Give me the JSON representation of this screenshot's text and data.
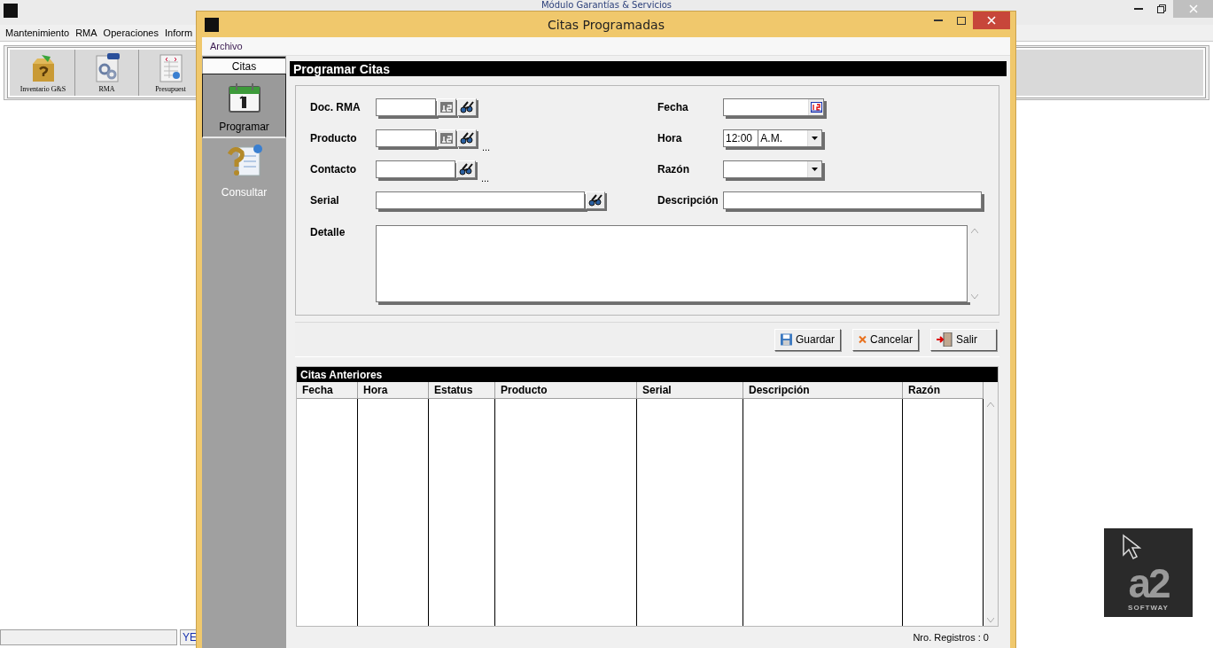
{
  "app_window": {
    "title": "Módulo Garantías & Servicios",
    "menu": [
      "Mantenimiento",
      "RMA",
      "Operaciones",
      "Inform"
    ],
    "toolbar": [
      {
        "label": "Inventario G&S",
        "kind": "box"
      },
      {
        "label": "RMA",
        "kind": "rma"
      },
      {
        "label": "Presupuest",
        "kind": "budget"
      }
    ],
    "status_bar": [
      "YE"
    ]
  },
  "dialog": {
    "title": "Citas Programadas",
    "menu": [
      "Archivo"
    ],
    "sidebar": {
      "header": "Citas",
      "items": [
        {
          "label": "Programar",
          "kind": "calendar",
          "selected": true
        },
        {
          "label": "Consultar",
          "kind": "query",
          "selected": false
        }
      ]
    },
    "form": {
      "title": "Programar Citas",
      "fields": [
        {
          "label": "Doc. RMA",
          "kind": "lookup",
          "a2": true
        },
        {
          "label": "Fecha",
          "kind": "date"
        },
        {
          "label": "Producto",
          "kind": "lookup",
          "a2": true,
          "more": "..."
        },
        {
          "label": "Hora",
          "kind": "time",
          "value": "12:00",
          "period": "A.M."
        },
        {
          "label": "Contacto",
          "kind": "lookup",
          "a2": false,
          "more": "..."
        },
        {
          "label": "Razón",
          "kind": "select"
        },
        {
          "label": "Serial",
          "kind": "wide_lookup"
        },
        {
          "label": "Descripción",
          "kind": "text"
        },
        {
          "label": "Detalle",
          "kind": "textarea"
        }
      ]
    },
    "buttons": [
      {
        "label": "Guardar",
        "kind": "save"
      },
      {
        "label": "Cancelar",
        "kind": "cancel"
      },
      {
        "label": "Salir",
        "kind": "exit"
      }
    ],
    "previous": {
      "title": "Citas Anteriores",
      "columns": [
        "Fecha",
        "Hora",
        "Estatus",
        "Producto",
        "Serial",
        "Descripción",
        "Razón"
      ],
      "footer": "Nro. Registros : 0"
    }
  },
  "logo": {
    "mark": "a2",
    "tagline": "SOFTWAY"
  }
}
